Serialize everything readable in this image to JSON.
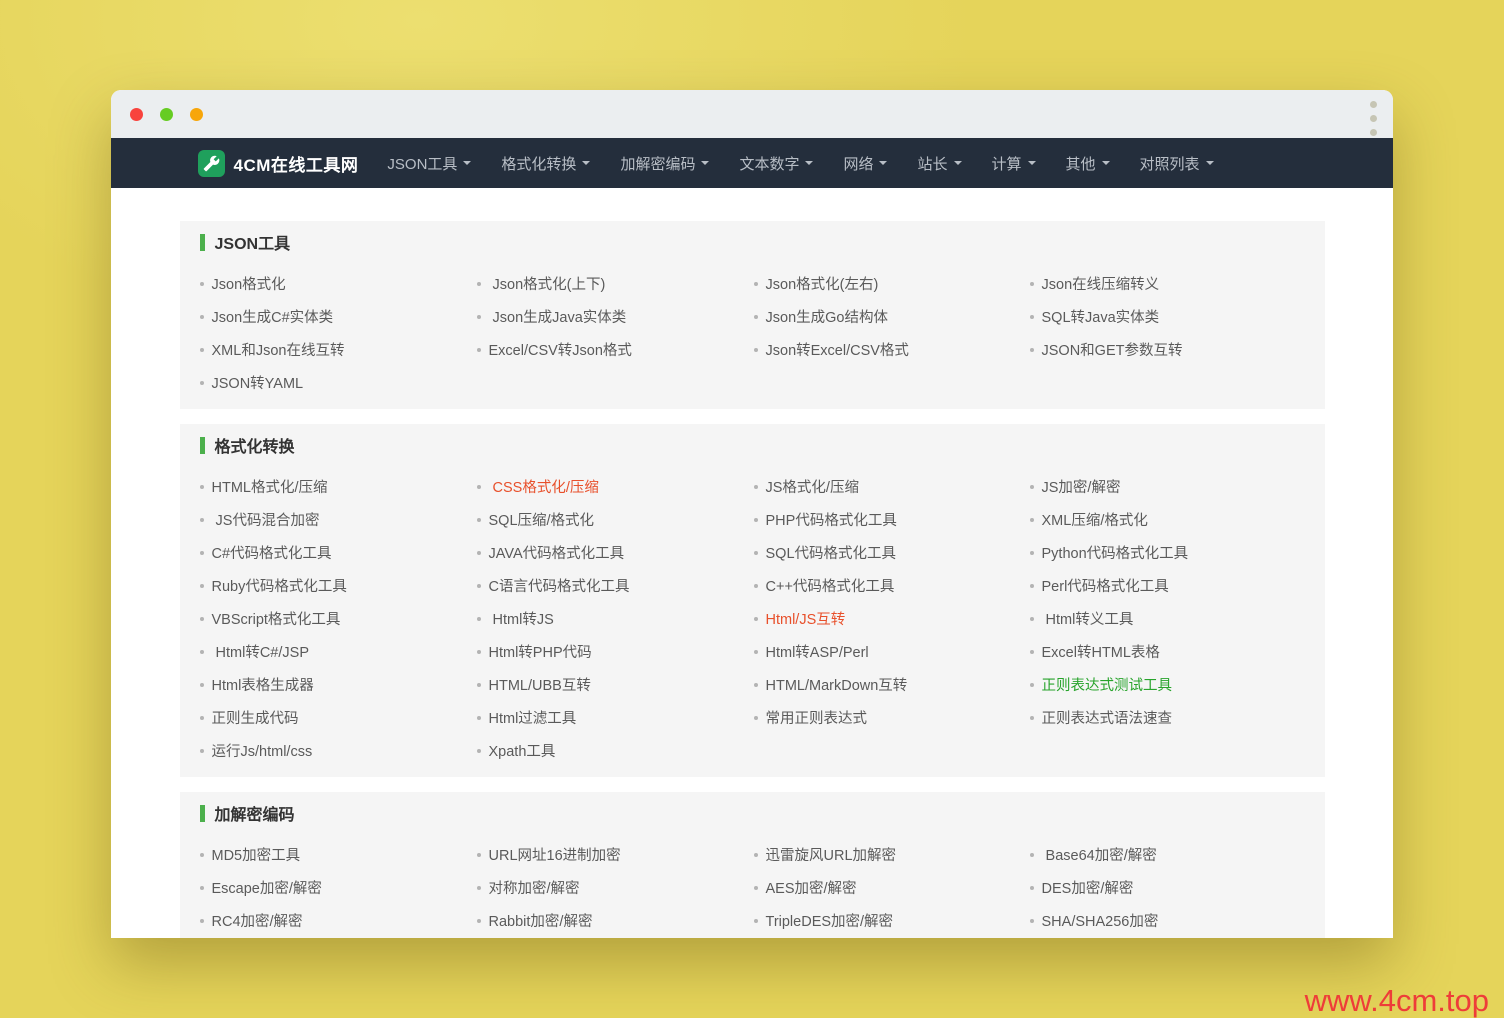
{
  "watermark": "www.4cm.top",
  "window_controls": {
    "close": "red-dot",
    "minimize": "green-dot",
    "maximize": "orange-dot",
    "menu": "kebab-menu"
  },
  "navbar": {
    "brand": "4CM在线工具网",
    "logo_icon": "wrench-icon",
    "items": [
      {
        "label": "JSON工具"
      },
      {
        "label": "格式化转换"
      },
      {
        "label": "加解密编码"
      },
      {
        "label": "文本数字"
      },
      {
        "label": "网络"
      },
      {
        "label": "站长"
      },
      {
        "label": "计算"
      },
      {
        "label": "其他"
      },
      {
        "label": "对照列表"
      }
    ]
  },
  "sections": [
    {
      "title": "JSON工具",
      "items": [
        {
          "label": "Json格式化"
        },
        {
          "label": " Json格式化(上下)"
        },
        {
          "label": "Json格式化(左右)"
        },
        {
          "label": "Json在线压缩转义"
        },
        {
          "label": "Json生成C#实体类"
        },
        {
          "label": " Json生成Java实体类"
        },
        {
          "label": "Json生成Go结构体"
        },
        {
          "label": "SQL转Java实体类"
        },
        {
          "label": "XML和Json在线互转"
        },
        {
          "label": "Excel/CSV转Json格式"
        },
        {
          "label": "Json转Excel/CSV格式"
        },
        {
          "label": "JSON和GET参数互转"
        },
        {
          "label": "JSON转YAML"
        }
      ]
    },
    {
      "title": "格式化转换",
      "items": [
        {
          "label": "HTML格式化/压缩"
        },
        {
          "label": " CSS格式化/压缩",
          "color": "red"
        },
        {
          "label": "JS格式化/压缩"
        },
        {
          "label": "JS加密/解密"
        },
        {
          "label": " JS代码混合加密"
        },
        {
          "label": "SQL压缩/格式化"
        },
        {
          "label": "PHP代码格式化工具"
        },
        {
          "label": "XML压缩/格式化"
        },
        {
          "label": "C#代码格式化工具"
        },
        {
          "label": "JAVA代码格式化工具"
        },
        {
          "label": "SQL代码格式化工具"
        },
        {
          "label": "Python代码格式化工具"
        },
        {
          "label": "Ruby代码格式化工具"
        },
        {
          "label": "C语言代码格式化工具"
        },
        {
          "label": "C++代码格式化工具"
        },
        {
          "label": "Perl代码格式化工具"
        },
        {
          "label": "VBScript格式化工具"
        },
        {
          "label": " Html转JS"
        },
        {
          "label": "Html/JS互转",
          "color": "red"
        },
        {
          "label": " Html转义工具"
        },
        {
          "label": " Html转C#/JSP"
        },
        {
          "label": "Html转PHP代码"
        },
        {
          "label": "Html转ASP/Perl"
        },
        {
          "label": "Excel转HTML表格"
        },
        {
          "label": "Html表格生成器"
        },
        {
          "label": "HTML/UBB互转"
        },
        {
          "label": "HTML/MarkDown互转"
        },
        {
          "label": "正则表达式测试工具",
          "color": "green"
        },
        {
          "label": "正则生成代码"
        },
        {
          "label": "Html过滤工具"
        },
        {
          "label": "常用正则表达式"
        },
        {
          "label": "正则表达式语法速查"
        },
        {
          "label": "运行Js/html/css"
        },
        {
          "label": "Xpath工具"
        }
      ]
    },
    {
      "title": "加解密编码",
      "clipped": true,
      "items": [
        {
          "label": "MD5加密工具"
        },
        {
          "label": "URL网址16进制加密"
        },
        {
          "label": "迅雷旋风URL加解密"
        },
        {
          "label": " Base64加密/解密"
        },
        {
          "label": "Escape加密/解密"
        },
        {
          "label": "对称加密/解密"
        },
        {
          "label": "AES加密/解密"
        },
        {
          "label": "DES加密/解密"
        },
        {
          "label": "RC4加密/解密"
        },
        {
          "label": "Rabbit加密/解密"
        },
        {
          "label": "TripleDES加密/解密"
        },
        {
          "label": "SHA/SHA256加密"
        }
      ]
    }
  ],
  "colors": {
    "desktop_background": "#e5d45a",
    "titlebar": "#ebeef0",
    "navbar_bg": "#242e3c",
    "brand_logo_green": "#1fa05c",
    "section_bg": "#f5f5f5",
    "accent_bar_green": "#4cb04c",
    "link_default": "#5a5a5a",
    "link_red": "#e8502b",
    "link_green": "#28a42c",
    "watermark_red": "#ee3d39",
    "traffic_red": "#f8433d",
    "traffic_green": "#66cc22",
    "traffic_orange": "#f7a60a"
  }
}
